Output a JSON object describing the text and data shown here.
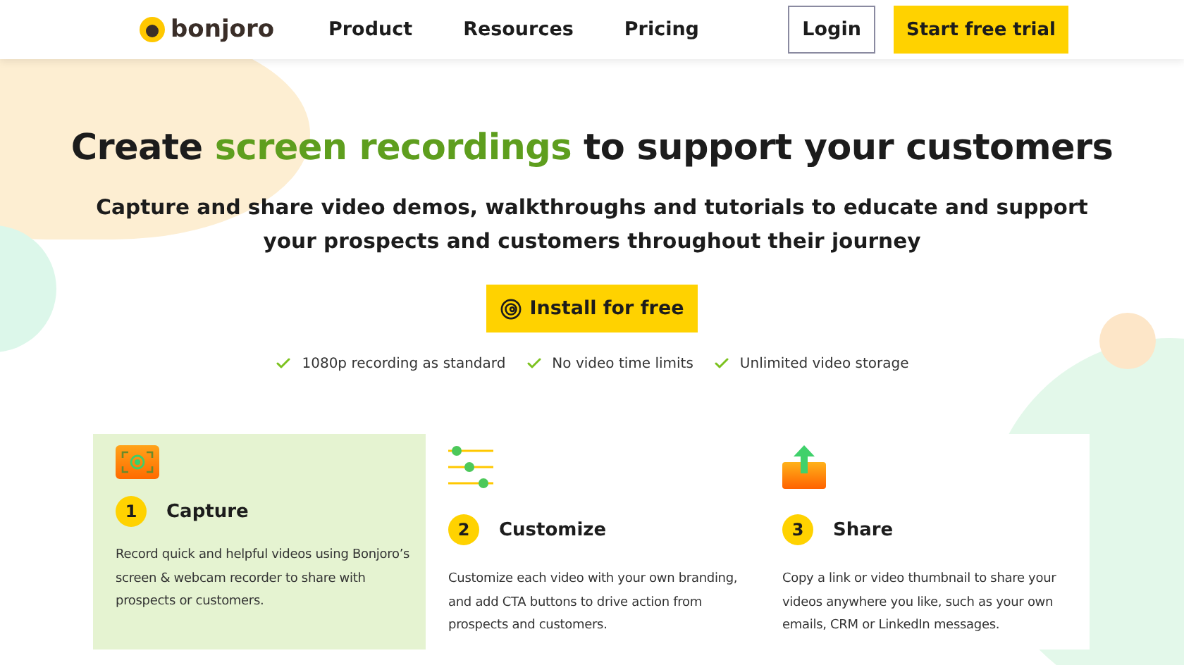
{
  "nav": {
    "logo": "bonjoro",
    "links": [
      "Product",
      "Resources",
      "Pricing"
    ],
    "login": "Login",
    "cta": "Start free trial"
  },
  "hero": {
    "title": "Create **screen recordings** to support your customers",
    "subtitle": "Capture and share video demos, walkthroughs and tutorials to educate and support your prospects and customers throughout their journey",
    "button": "Install for free",
    "perks": [
      "1080p recording as standard",
      "No video time limits",
      "Unlimited video storage"
    ]
  },
  "steps": [
    {
      "kind": "capture",
      "number": "1",
      "title": "Capture",
      "text": "Record quick and helpful videos using Bonjoro’s screen & webcam recorder to share with prospects or customers.",
      "selected": true
    },
    {
      "kind": "customize",
      "number": "2",
      "title": "Customize",
      "text": "Customize each video with your own branding, and add CTA buttons to drive action from prospects and customers.",
      "selected": false
    },
    {
      "kind": "share",
      "number": "3",
      "title": "Share",
      "text": "Copy a link or video thumbnail to share your videos anywhere you like, such as your own emails, CRM or LinkedIn messages.",
      "selected": false
    }
  ]
}
